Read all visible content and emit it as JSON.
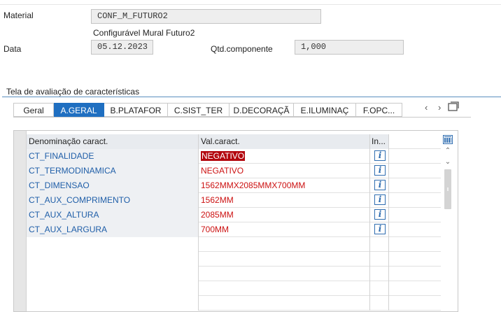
{
  "header": {
    "material_label": "Material",
    "material_value": "CONF_M_FUTURO2",
    "material_description": "Configurável Mural Futuro2",
    "date_label": "Data",
    "date_value": "05.12.2023",
    "qty_label": "Qtd.componente",
    "qty_value": "1,000"
  },
  "group_title": "Tela de avaliação de características",
  "tabs": [
    {
      "label": "Geral",
      "active": false
    },
    {
      "label": "A.GERAL",
      "active": true
    },
    {
      "label": "B.PLATAFOR",
      "active": false
    },
    {
      "label": "C.SIST_TER",
      "active": false
    },
    {
      "label": "D.DECORAÇÃ",
      "active": false
    },
    {
      "label": "E.ILUMINAÇ",
      "active": false
    },
    {
      "label": "F.OPC...",
      "active": false
    }
  ],
  "tab_nav": {
    "prev": "‹",
    "next": "›",
    "list": "list-tabs-icon"
  },
  "grid": {
    "columns": [
      "Denominação caract.",
      "Val.caract.",
      "In..."
    ],
    "rows": [
      {
        "name": "CT_FINALIDADE",
        "value": "NEGATIVO",
        "selected": true
      },
      {
        "name": "CT_TERMODINAMICA",
        "value": "NEGATIVO",
        "selected": false
      },
      {
        "name": "CT_DIMENSAO",
        "value": "1562MMX2085MMX700MM",
        "selected": false
      },
      {
        "name": "CT_AUX_COMPRIMENTO",
        "value": "1562MM",
        "selected": false
      },
      {
        "name": "CT_AUX_ALTURA",
        "value": "2085MM",
        "selected": false
      },
      {
        "name": "CT_AUX_LARGURA",
        "value": "700MM",
        "selected": false
      }
    ],
    "empty_rows": 5,
    "info_icon": "info-icon",
    "config_icon": "column-config-icon"
  },
  "colors": {
    "accent": "#1f6fc1",
    "value_text": "#cc1111",
    "name_text": "#1f5ea8",
    "selected_value_bg": "#b3070e"
  }
}
